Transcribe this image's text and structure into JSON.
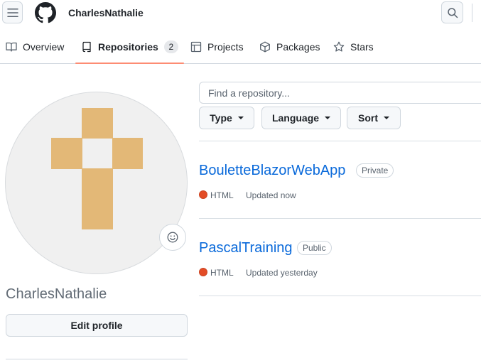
{
  "header": {
    "username": "CharlesNathalie"
  },
  "tabs": [
    {
      "label": "Overview"
    },
    {
      "label": "Repositories",
      "count": "2",
      "active": true
    },
    {
      "label": "Projects"
    },
    {
      "label": "Packages"
    },
    {
      "label": "Stars"
    }
  ],
  "profile": {
    "name": "CharlesNathalie",
    "edit_label": "Edit profile",
    "avatar_color": "#e3b877"
  },
  "repos_panel": {
    "search_placeholder": "Find a repository...",
    "filters": [
      "Type",
      "Language",
      "Sort"
    ]
  },
  "repositories": [
    {
      "name": "BouletteBlazorWebApp",
      "visibility": "Private",
      "language": "HTML",
      "language_color": "#e34c26",
      "updated": "Updated now"
    },
    {
      "name": "PascalTraining",
      "visibility": "Public",
      "language": "HTML",
      "language_color": "#e34c26",
      "updated": "Updated yesterday"
    }
  ],
  "colors": {
    "accent_link": "#0969da",
    "tab_underline": "#fd8c73"
  }
}
